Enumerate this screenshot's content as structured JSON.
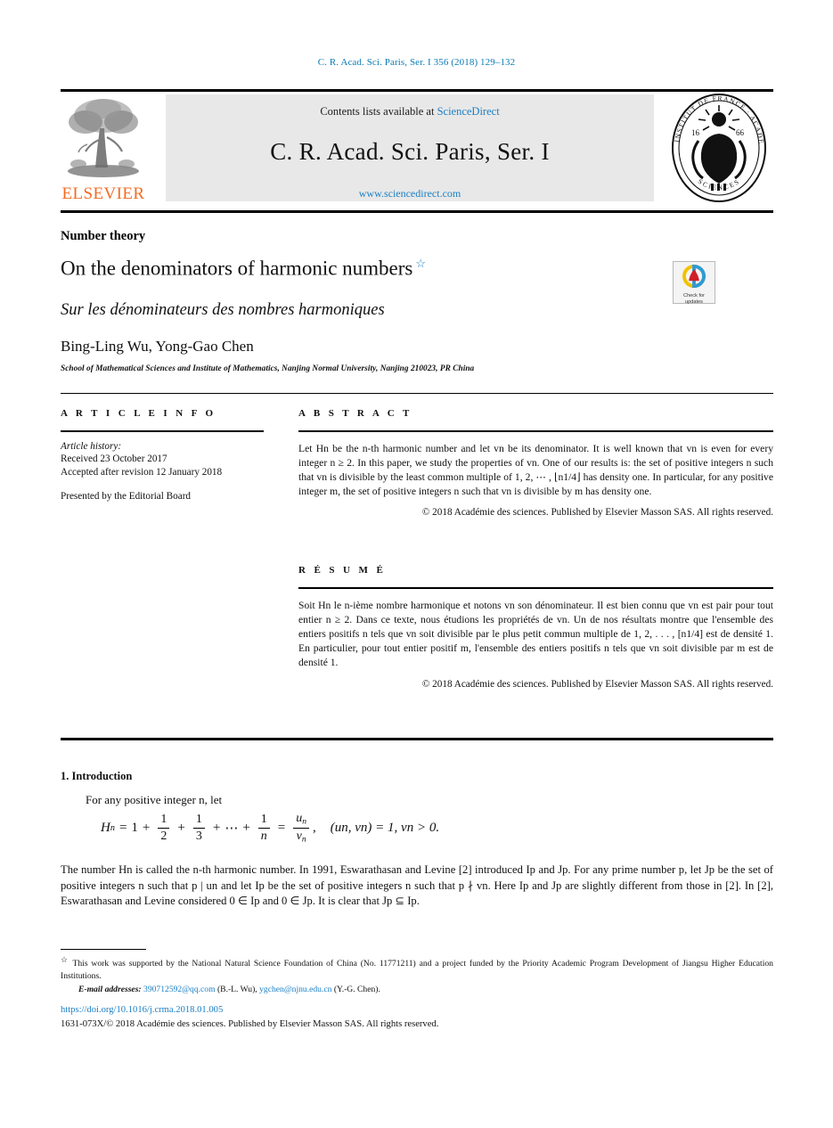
{
  "running_head": "C. R. Acad. Sci. Paris, Ser. I 356 (2018) 129–132",
  "masthead": {
    "contents_prefix": "Contents lists available at ",
    "sciencedirect": "ScienceDirect",
    "journal_title": "C. R. Acad. Sci. Paris, Ser. I",
    "url": "www.sciencedirect.com",
    "publisher_logo_text": "ELSEVIER",
    "seal_alt": "Académie des sciences — Institut de France seal",
    "accent_orange": "#f36b21",
    "link_blue": "#1b7fc4",
    "band_gray": "#e8e8e8"
  },
  "title_block": {
    "subject": "Number theory",
    "title": "On the denominators of harmonic numbers",
    "title_footnote_marker": "☆",
    "title_fr": "Sur les dénominateurs des nombres harmoniques",
    "authors": "Bing-Ling Wu, Yong-Gao Chen",
    "affiliation": "School of Mathematical Sciences and Institute of Mathematics, Nanjing Normal University, Nanjing 210023, PR China",
    "crossmark_line1": "Check for",
    "crossmark_line2": "updates"
  },
  "article_info": {
    "heading": "A R T I C L E     I N F O",
    "history_label": "Article history:",
    "received": "Received 23 October 2017",
    "accepted": "Accepted after revision 12 January 2018",
    "presented": "Presented by the Editorial Board"
  },
  "abstract": {
    "heading": "A B S T R A C T",
    "text": "Let Hn be the n-th harmonic number and let vn be its denominator. It is well known that vn is even for every integer n ≥ 2. In this paper, we study the properties of vn. One of our results is: the set of positive integers n such that vn is divisible by the least common multiple of 1, 2, ⋯ , ⌊n1/4⌋ has density one. In particular, for any positive integer m, the set of positive integers n such that vn is divisible by m has density one.",
    "copyright": "© 2018 Académie des sciences. Published by Elsevier Masson SAS. All rights reserved."
  },
  "resume": {
    "heading": "R É S U M É",
    "text": "Soit Hn le n-ième nombre harmonique et notons vn son dénominateur. Il est bien connu que vn est pair pour tout entier n ≥ 2. Dans ce texte, nous étudions les propriétés de vn. Un de nos résultats montre que l'ensemble des entiers positifs n tels que vn soit divisible par le plus petit commun multiple de 1, 2, . . . , [n1/4] est de densité 1. En particulier, pour tout entier positif m, l'ensemble des entiers positifs n tels que vn soit divisible par m est de densité 1.",
    "copyright": "© 2018 Académie des sciences. Published by Elsevier Masson SAS. All rights reserved."
  },
  "body": {
    "section_number": "1.",
    "section_title": "Introduction",
    "lead": "For any positive integer n, let",
    "equation": {
      "lhs": "H",
      "lhs_sub": "n",
      "eq": "=",
      "one": "1",
      "plus": "+",
      "f1_num": "1",
      "f1_den": "2",
      "f2_num": "1",
      "f2_den": "3",
      "dots": "⋯",
      "f3_num": "1",
      "f3_den": "n",
      "rhs_num": "u",
      "rhs_num_sub": "n",
      "rhs_den": "v",
      "rhs_den_sub": "n",
      "comma": ",",
      "cond": "(un, vn) = 1,  vn > 0."
    },
    "paragraph": "The number Hn is called the n-th harmonic number. In 1991, Eswarathasan and Levine [2] introduced Ip and Jp. For any prime number p, let Jp be the set of positive integers n such that p | un and let Ip be the set of positive integers n such that p ∤ vn. Here Ip and Jp are slightly different from those in [2]. In [2], Eswarathasan and Levine considered 0 ∈ Ip and 0 ∈ Jp. It is clear that Jp ⊆ Ip."
  },
  "footer": {
    "footnote_marker": "☆",
    "footnote": "This work was supported by the National Natural Science Foundation of China (No. 11771211) and a project funded by the Priority Academic Program Development of Jiangsu Higher Education Institutions.",
    "email_label": "E-mail addresses:",
    "email1": "390712592@qq.com",
    "email1_author": "(B.-L. Wu),",
    "email2": "ygchen@njnu.edu.cn",
    "email2_author": "(Y.-G. Chen).",
    "doi": "https://doi.org/10.1016/j.crma.2018.01.005",
    "issn_copyright": "1631-073X/© 2018 Académie des sciences. Published by Elsevier Masson SAS. All rights reserved."
  }
}
